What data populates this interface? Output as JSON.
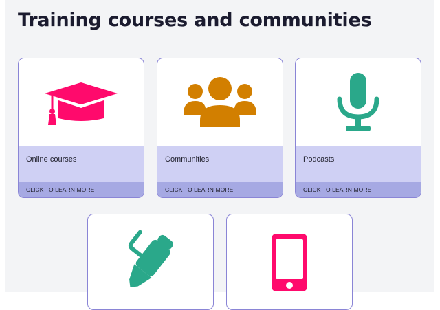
{
  "page": {
    "title": "Training courses and communities"
  },
  "cards": [
    {
      "label": "Online courses",
      "cta": "CLICK TO LEARN MORE",
      "icon": "graduation-cap-icon",
      "color": "#ff0a6c"
    },
    {
      "label": "Communities",
      "cta": "CLICK TO LEARN MORE",
      "icon": "users-group-icon",
      "color": "#d27f00"
    },
    {
      "label": "Podcasts",
      "cta": "CLICK TO LEARN MORE",
      "icon": "microphone-icon",
      "color": "#2aa88a"
    },
    {
      "icon": "pen-icon",
      "color": "#2aa88a"
    },
    {
      "icon": "smartphone-icon",
      "color": "#ff0a6c"
    }
  ],
  "colors": {
    "card_border": "#8a85d6",
    "label_band": "#cfd0f4",
    "cta_band": "#a6a9e3",
    "page_bg": "#f3f4f6"
  }
}
